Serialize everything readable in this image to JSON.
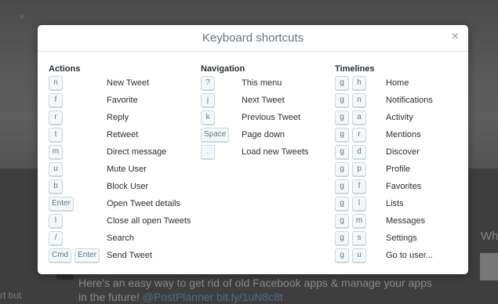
{
  "modal": {
    "title": "Keyboard shortcuts",
    "close_icon": "close-icon",
    "close_glyph": "×"
  },
  "background": {
    "tweet_text_1": "Here's an easy way to get rid of old Facebook apps & manage your apps",
    "tweet_text_2a": "in the future! ",
    "tweet_text_2b": "@PostPlanner bit.ly/1uN8c8t",
    "side_text": "rt but",
    "right_text": "Wh",
    "close_glyph": "×"
  },
  "columns": [
    {
      "title": "Actions",
      "shortcuts": [
        {
          "keys": [
            "n"
          ],
          "label": "New Tweet"
        },
        {
          "keys": [
            "f"
          ],
          "label": "Favorite"
        },
        {
          "keys": [
            "r"
          ],
          "label": "Reply"
        },
        {
          "keys": [
            "t"
          ],
          "label": "Retweet"
        },
        {
          "keys": [
            "m"
          ],
          "label": "Direct message"
        },
        {
          "keys": [
            "u"
          ],
          "label": "Mute User"
        },
        {
          "keys": [
            "b"
          ],
          "label": "Block User"
        },
        {
          "keys": [
            "Enter"
          ],
          "label": "Open Tweet details"
        },
        {
          "keys": [
            "l"
          ],
          "label": "Close all open Tweets"
        },
        {
          "keys": [
            "/"
          ],
          "label": "Search"
        },
        {
          "keys": [
            "Cmd",
            "Enter"
          ],
          "label": "Send Tweet"
        }
      ]
    },
    {
      "title": "Navigation",
      "shortcuts": [
        {
          "keys": [
            "?"
          ],
          "label": "This menu"
        },
        {
          "keys": [
            "j"
          ],
          "label": "Next Tweet"
        },
        {
          "keys": [
            "k"
          ],
          "label": "Previous Tweet"
        },
        {
          "keys": [
            "Space"
          ],
          "label": "Page down"
        },
        {
          "keys": [
            "."
          ],
          "label": "Load new Tweets"
        }
      ]
    },
    {
      "title": "Timelines",
      "shortcuts": [
        {
          "keys": [
            "g",
            "h"
          ],
          "label": "Home"
        },
        {
          "keys": [
            "g",
            "n"
          ],
          "label": "Notifications"
        },
        {
          "keys": [
            "g",
            "a"
          ],
          "label": "Activity"
        },
        {
          "keys": [
            "g",
            "r"
          ],
          "label": "Mentions"
        },
        {
          "keys": [
            "g",
            "d"
          ],
          "label": "Discover"
        },
        {
          "keys": [
            "g",
            "p"
          ],
          "label": "Profile"
        },
        {
          "keys": [
            "g",
            "f"
          ],
          "label": "Favorites"
        },
        {
          "keys": [
            "g",
            "l"
          ],
          "label": "Lists"
        },
        {
          "keys": [
            "g",
            "m"
          ],
          "label": "Messages"
        },
        {
          "keys": [
            "g",
            "s"
          ],
          "label": "Settings"
        },
        {
          "keys": [
            "g",
            "u"
          ],
          "label": "Go to user..."
        }
      ]
    }
  ]
}
